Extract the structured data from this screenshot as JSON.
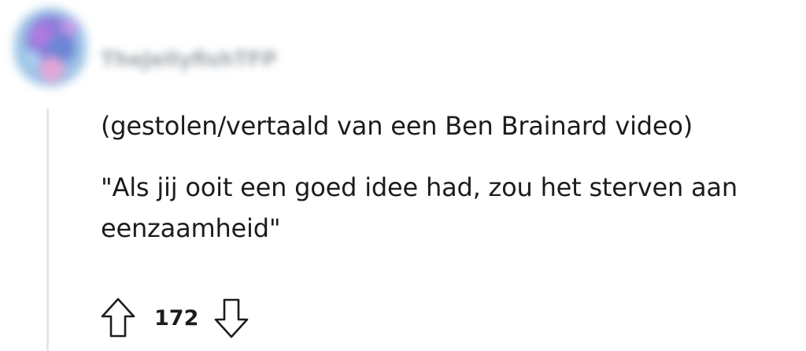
{
  "comment": {
    "author": "TheJellyfishTFP",
    "paragraphs": [
      "(gestolen/vertaald van een Ben Brainard video)",
      "\"Als jij ooit een goed idee had, zou het sterven aan eenzaamheid\""
    ],
    "score": "172"
  },
  "icons": {
    "upvote": "arrow-up-icon",
    "downvote": "arrow-down-icon"
  },
  "colors": {
    "text": "#1c1c1c",
    "thread_line": "#e6e6e6",
    "avatar_primary": "#8a7bd8"
  }
}
